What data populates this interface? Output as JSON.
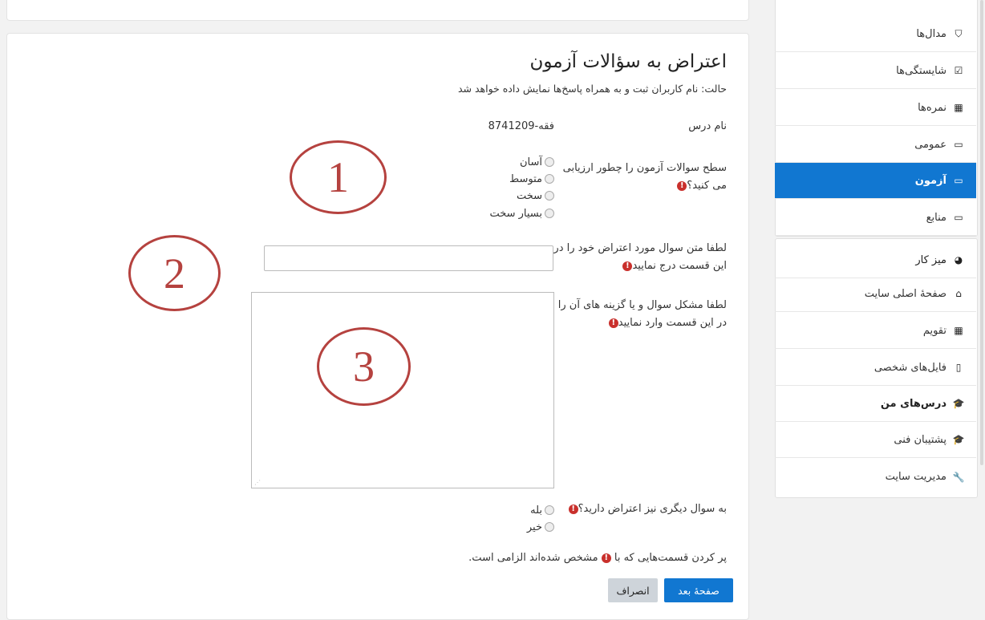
{
  "sidebar": {
    "items": [
      {
        "label": "مدال‌ها",
        "icon": "shield-icon",
        "glyph": "⛉"
      },
      {
        "label": "شایستگی‌ها",
        "icon": "checkbox-icon",
        "glyph": "☑"
      },
      {
        "label": "نمره‌ها",
        "icon": "table-icon",
        "glyph": "▦"
      },
      {
        "label": "عمومی",
        "icon": "folder-icon",
        "glyph": "▭"
      },
      {
        "label": "آزمون",
        "icon": "folder-icon",
        "glyph": "▭"
      },
      {
        "label": "منابع",
        "icon": "folder-icon",
        "glyph": "▭"
      },
      {
        "label": "میز کار",
        "icon": "dashboard-icon",
        "glyph": "◕"
      },
      {
        "label": "صفحهٔ اصلی سایت",
        "icon": "home-icon",
        "glyph": "⌂"
      },
      {
        "label": "تقویم",
        "icon": "calendar-icon",
        "glyph": "▦"
      },
      {
        "label": "فایل‌های شخصی",
        "icon": "file-icon",
        "glyph": "▯"
      },
      {
        "label": "درس‌های من",
        "icon": "graduation-cap-icon",
        "glyph": "🎓"
      },
      {
        "label": "پشتیبان فنی",
        "icon": "graduation-cap-icon",
        "glyph": "🎓"
      },
      {
        "label": "مدیریت سایت",
        "icon": "wrench-icon",
        "glyph": "🔧"
      }
    ],
    "accent": "#1177d1"
  },
  "form": {
    "title": "اعتراض به سؤالات آزمون",
    "status": "حالت: نام کاربران ثبت و به همراه پاسخ‌ها نمایش داده خواهد شد",
    "course_label": "نام درس",
    "course_value": "فقه-8741209",
    "q1_label_line1": "سطح سوالات آزمون را چطور ارزیابی",
    "q1_label_line2": "می کنید؟",
    "q1_options": [
      "آسان",
      "متوسط",
      "سخت",
      "بسیار سخت"
    ],
    "q2_label_line1": "لطفا متن سوال مورد اعتراض خود را در",
    "q2_label_line2": "این قسمت درج نمایید",
    "q2_value": "",
    "q3_label_line1": "لطفا مشکل سوال و یا گزینه های آن را",
    "q3_label_line2": "در این قسمت وارد نمایید",
    "q3_value": "",
    "q4_label": "به سوال دیگری نیز اعتراض دارید؟",
    "q4_options": [
      "بله",
      "خیر"
    ],
    "required_note_before": "پر کردن قسمت‌هایی که با",
    "required_note_after": "مشخص شده‌اند الزامی است.",
    "required_glyph": "!",
    "next_button": "صفحهٔ بعد",
    "cancel_button": "انصراف",
    "required_color": "#c9302c"
  },
  "annotations": [
    "1",
    "2",
    "3"
  ]
}
